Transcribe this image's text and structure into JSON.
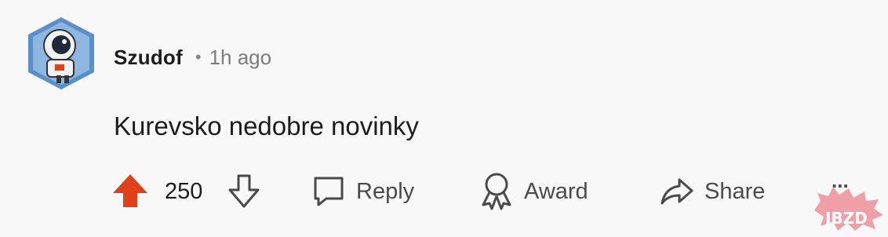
{
  "comment": {
    "author": "Szudof",
    "separator": "•",
    "time_ago": "1h ago",
    "body": "Kurevsko nedobre novinky"
  },
  "votes": {
    "score": "250",
    "upvote_state": "upvoted"
  },
  "actions": {
    "reply_label": "Reply",
    "award_label": "Award",
    "share_label": "Share",
    "more_label": "..."
  },
  "watermark": {
    "text": "JBZD"
  },
  "colors": {
    "upvote_active": "#e0411b",
    "muted": "#878a8c",
    "text": "#1c1c1c",
    "avatar_bg": "#5b8fc7"
  },
  "icons": {
    "upvote": "arrow-up-icon",
    "downvote": "arrow-down-icon",
    "reply": "speech-bubble-icon",
    "award": "award-ribbon-icon",
    "share": "share-arrow-icon",
    "more": "more-dots-icon"
  }
}
